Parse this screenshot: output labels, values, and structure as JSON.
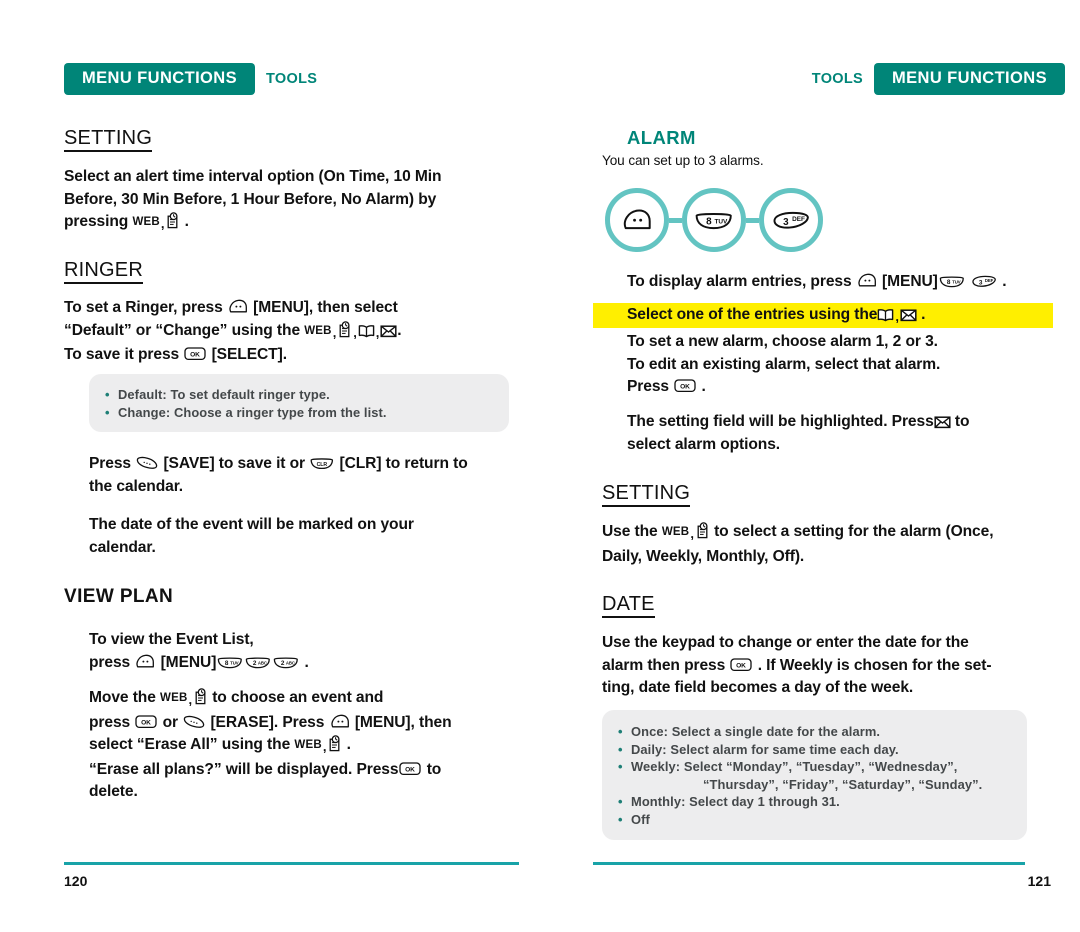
{
  "document": {
    "left_page_number": "120",
    "right_page_number": "121"
  },
  "header": {
    "badge_label": "MENU FUNCTIONS",
    "section_label": "TOOLS"
  },
  "colors": {
    "teal": "#008578",
    "rule_teal": "#18a3a8",
    "circle_teal": "#63c4c2",
    "highlight_yellow": "#ffef00",
    "note_gray": "#ededee",
    "note_text": "#44484a"
  },
  "left_page": {
    "setting": {
      "heading": "SETTING",
      "line1": "Select an alert time interval option (On Time, 10 Min",
      "line2": "Before, 30 Min Before, 1 Hour Before, No Alarm) by",
      "line3_prefix": "pressing",
      "line3_web": "WEB",
      "line3_suffix": "."
    },
    "ringer": {
      "heading": "RINGER",
      "line1_prefix": "To set a Ringer, press",
      "line1_suffix": "[MENU], then select",
      "line2_prefix": "“Default” or “Change” using the",
      "line2_web": "WEB",
      "line2_suffix": ".",
      "line3_prefix": "To save it press",
      "line3_suffix": "[SELECT].",
      "note_items": [
        "Default: To set default ringer type.",
        "Change: Choose a ringer type from the list."
      ],
      "save_line1_a": "Press",
      "save_line1_b": "[SAVE] to save it or",
      "save_line1_c": "[CLR] to return to",
      "save_line2": "the calendar.",
      "marked_line1": "The date of the event will be marked on your",
      "marked_line2": "calendar."
    },
    "view_plan": {
      "heading": "VIEW PLAN",
      "line1": "To view the Event List,",
      "line2_prefix": "press",
      "line2_menu": "[MENU]",
      "line2_suffix": ".",
      "line3_prefix": "Move the",
      "line3_web": "WEB",
      "line3_suffix": "to choose an event and",
      "line4_a": "press",
      "line4_b": "or",
      "line4_c": "[ERASE]. Press",
      "line4_d": "[MENU], then",
      "line5_prefix": "select “Erase All” using the",
      "line5_web": "WEB",
      "line5_suffix": ".",
      "line6_prefix": "“Erase all plans?” will be displayed. Press",
      "line6_suffix": "to",
      "line7": "delete."
    }
  },
  "right_page": {
    "alarm": {
      "heading": "ALARM",
      "subtitle": "You can set up to 3 alarms.",
      "keys": [
        {
          "name": "menu-key",
          "label": ""
        },
        {
          "name": "key-8-tuv",
          "digit": "8",
          "letters": "TUV"
        },
        {
          "name": "key-3-def",
          "digit": "3",
          "letters": "DEF"
        }
      ],
      "display_line_prefix": "To display alarm entries, press",
      "display_line_menu": "[MENU]",
      "display_line_suffix": ".",
      "highlight_line_prefix": "Select one of the entries using the",
      "highlight_line_suffix": ".",
      "line_new_alarm": "To set a new alarm, choose alarm 1, 2 or 3.",
      "line_edit_alarm": "To edit an existing alarm, select that alarm.",
      "line_press_prefix": "Press",
      "line_press_suffix": ".",
      "setting_field_line1_a": "The setting field will be highlighted. Press",
      "setting_field_line1_b": "to",
      "setting_field_line2": "select alarm options."
    },
    "setting": {
      "heading": "SETTING",
      "line1_prefix": "Use the",
      "line1_web": "WEB",
      "line1_suffix": "to select a setting for the alarm (Once,",
      "line2": "Daily, Weekly, Monthly, Off)."
    },
    "date": {
      "heading": "DATE",
      "line1": "Use the keypad to change or enter the date for the",
      "line2_prefix": "alarm then press",
      "line2_suffix": ". If Weekly is chosen for the set-",
      "line3": "ting, date field becomes a day of the week.",
      "note_items": [
        {
          "text": "Once: Select a single date for the alarm.",
          "bullet": true,
          "indent": false
        },
        {
          "text": "Daily: Select alarm for same time each day.",
          "bullet": true,
          "indent": false
        },
        {
          "text": "Weekly: Select “Monday”, “Tuesday”, “Wednesday”,",
          "bullet": true,
          "indent": false
        },
        {
          "text": "“Thursday”, “Friday”, “Saturday”, “Sunday”.",
          "bullet": false,
          "indent": true
        },
        {
          "text": "Monthly: Select day 1 through 31.",
          "bullet": true,
          "indent": false
        },
        {
          "text": "Off",
          "bullet": true,
          "indent": false
        }
      ]
    }
  }
}
